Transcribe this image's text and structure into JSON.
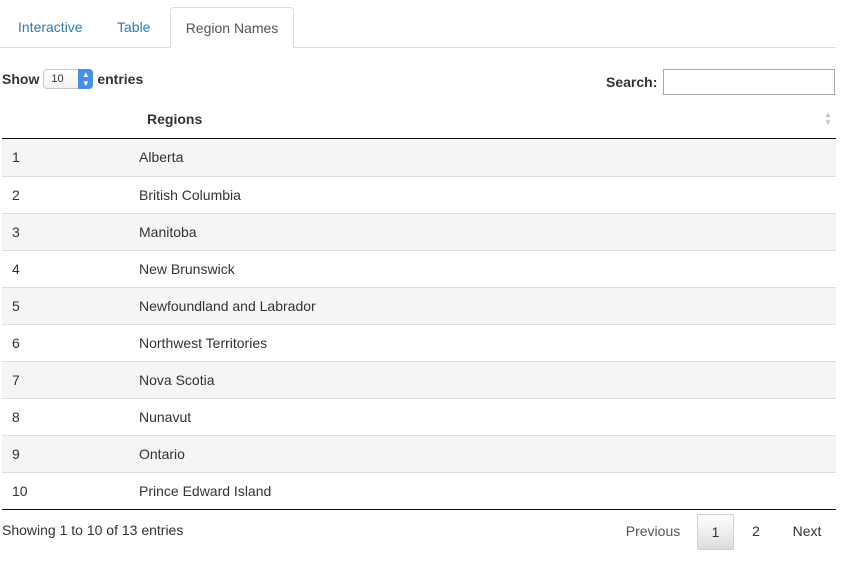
{
  "tabs": [
    {
      "label": "Interactive",
      "active": false
    },
    {
      "label": "Table",
      "active": false
    },
    {
      "label": "Region Names",
      "active": true
    }
  ],
  "length_control": {
    "prefix": "Show",
    "value": "10",
    "suffix": "entries"
  },
  "search": {
    "label": "Search:",
    "value": ""
  },
  "table": {
    "columns": [
      "",
      "Regions"
    ],
    "rows": [
      {
        "num": "1",
        "name": "Alberta"
      },
      {
        "num": "2",
        "name": "British Columbia"
      },
      {
        "num": "3",
        "name": "Manitoba"
      },
      {
        "num": "4",
        "name": "New Brunswick"
      },
      {
        "num": "5",
        "name": "Newfoundland and Labrador"
      },
      {
        "num": "6",
        "name": "Northwest Territories"
      },
      {
        "num": "7",
        "name": "Nova Scotia"
      },
      {
        "num": "8",
        "name": "Nunavut"
      },
      {
        "num": "9",
        "name": "Ontario"
      },
      {
        "num": "10",
        "name": "Prince Edward Island"
      }
    ]
  },
  "footer": {
    "info": "Showing 1 to 10 of 13 entries",
    "pagination": {
      "previous": "Previous",
      "pages": [
        "1",
        "2"
      ],
      "current": "1",
      "next": "Next"
    }
  },
  "colors": {
    "link": "#337ab7",
    "striped_row": "#f5f5f5",
    "select_accent": "#4a8fe7"
  }
}
